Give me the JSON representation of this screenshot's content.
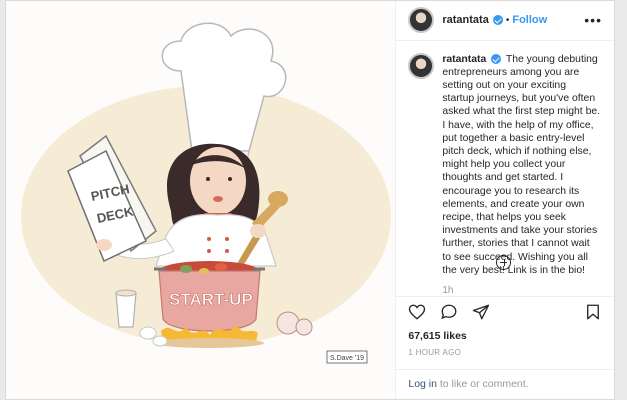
{
  "post": {
    "username": "ratantata",
    "follow_label": "Follow",
    "separator": "•",
    "more_label": "•••",
    "caption": "The young debuting entrepreneurs among you are setting out on your exciting startup journeys, but you've often asked what the first step might be. I have, with the help of my office, put together a basic entry-level pitch deck, which if nothing else, might help you collect your thoughts and get started. I encourage you to research its elements, and create your own recipe, that helps you seek investments and take your stories further, stories that I cannot wait to see succeed. Wishing you all the very best! Link is in the bio!",
    "caption_time": "1h",
    "likes": "67,615 likes",
    "posted_ago": "1 HOUR AGO",
    "login_link": "Log in",
    "comment_prompt": " to like or comment."
  },
  "illustration": {
    "menu_text_line1": "PITCH",
    "menu_text_line2": "DECK",
    "pot_text": "START-UP",
    "signature": "S.Dave '19"
  },
  "icons": {
    "verified": "verified-badge-icon",
    "like": "heart-icon",
    "comment": "comment-bubble-icon",
    "share": "paper-plane-icon",
    "save": "bookmark-icon",
    "load_more": "plus-circle-icon"
  }
}
